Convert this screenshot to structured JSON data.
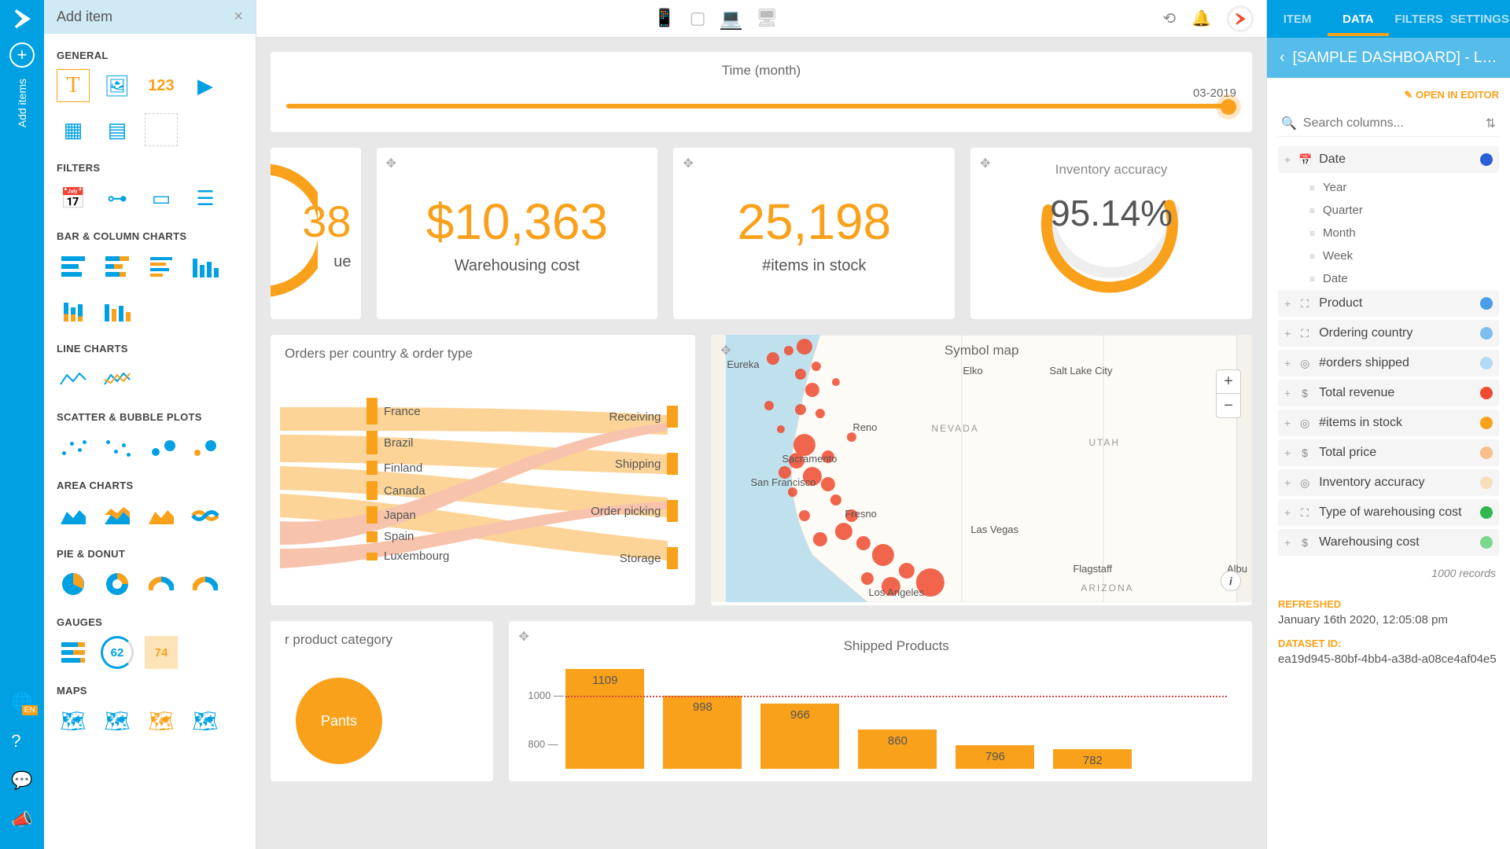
{
  "leftRail": {
    "addLabel": "Add items",
    "langBadge": "EN"
  },
  "addPanel": {
    "title": "Add item",
    "sections": {
      "general": "GENERAL",
      "filters": "FILTERS",
      "bar": "BAR & COLUMN CHARTS",
      "line": "LINE CHARTS",
      "scatter": "SCATTER & BUBBLE PLOTS",
      "area": "AREA CHARTS",
      "pie": "PIE & DONUT",
      "gauges": "GAUGES",
      "maps": "MAPS"
    },
    "numeric_tile": "123",
    "gauge62": "62",
    "gauge74": "74"
  },
  "timeCard": {
    "title": "Time (month)",
    "value": "03-2019"
  },
  "kpis": {
    "cutoff_value": "38",
    "cutoff_label": "ue",
    "warehousing_value": "$10,363",
    "warehousing_label": "Warehousing cost",
    "items_value": "25,198",
    "items_label": "#items in stock",
    "accuracy_title": "Inventory accuracy",
    "accuracy_value": "95.14%"
  },
  "sankey": {
    "title": "Orders per country & order type",
    "left": [
      "France",
      "Brazil",
      "Finland",
      "Canada",
      "Japan",
      "Spain",
      "Luxembourg"
    ],
    "right": [
      "Receiving",
      "Shipping",
      "Order picking",
      "Storage"
    ]
  },
  "map": {
    "title": "Symbol map",
    "cities": [
      "Eureka",
      "Elko",
      "Salt Lake City",
      "Reno",
      "Sacramento",
      "San Francisco",
      "Fresno",
      "Las Vegas",
      "Flagstaff",
      "Los Angeles",
      "Albu"
    ],
    "states": [
      "NEVADA",
      "UTAH",
      "ARIZONA"
    ]
  },
  "productPanel": {
    "title_fragment": "r product category",
    "bubble": "Pants"
  },
  "shipped": {
    "title": "Shipped Products"
  },
  "chart_data": {
    "type": "bar",
    "title": "Shipped Products",
    "categories": [
      "",
      "",
      "",
      "",
      "",
      ""
    ],
    "values": [
      1109,
      998,
      966,
      860,
      796,
      782
    ],
    "reference_line": 1000,
    "yticks": [
      800,
      1000
    ],
    "ylim": [
      700,
      1150
    ]
  },
  "rightPanel": {
    "tabs": [
      "ITEM",
      "DATA",
      "FILTERS",
      "SETTINGS"
    ],
    "activeTab": "DATA",
    "heading": "[SAMPLE DASHBOARD] - Log…",
    "openEditor": "OPEN IN EDITOR",
    "searchPlaceholder": "Search columns...",
    "fields": [
      {
        "name": "Date",
        "icon": "calendar",
        "color": "#2b5fd9",
        "children": [
          "Year",
          "Quarter",
          "Month",
          "Week",
          "Date"
        ]
      },
      {
        "name": "Product",
        "icon": "hierarchy",
        "color": "#4a9de8"
      },
      {
        "name": "Ordering country",
        "icon": "hierarchy",
        "color": "#7cbef0"
      },
      {
        "name": "#orders shipped",
        "icon": "target",
        "color": "#b3daf5"
      },
      {
        "name": "Total revenue",
        "icon": "dollar",
        "color": "#ef4b2f"
      },
      {
        "name": "#items in stock",
        "icon": "target",
        "color": "#f9a11b"
      },
      {
        "name": "Total price",
        "icon": "dollar",
        "color": "#f7c08a"
      },
      {
        "name": "Inventory accuracy",
        "icon": "target",
        "color": "#f7debf"
      },
      {
        "name": "Type of warehousing cost",
        "icon": "hierarchy",
        "color": "#2fb84d"
      },
      {
        "name": "Warehousing cost",
        "icon": "dollar",
        "color": "#7dd88f"
      }
    ],
    "records": "1000 records",
    "refreshedLabel": "REFRESHED",
    "refreshedVal": "January 16th 2020, 12:05:08 pm",
    "datasetLabel": "DATASET ID:",
    "datasetVal": "ea19d945-80bf-4bb4-a38d-a08ce4af04e5"
  }
}
